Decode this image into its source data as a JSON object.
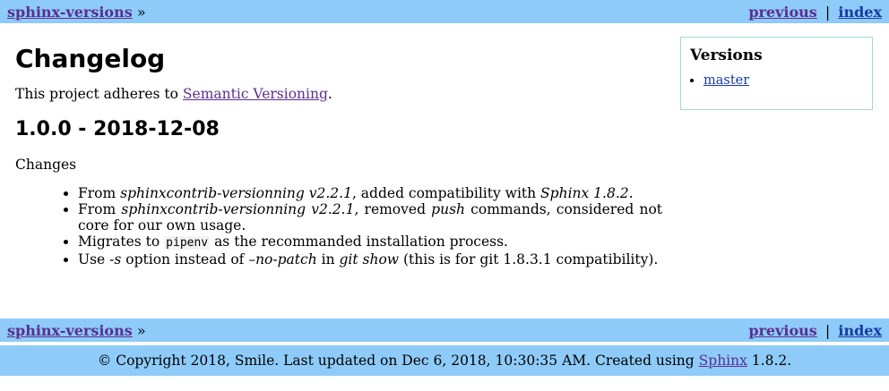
{
  "topbar": {
    "project_link": "sphinx-versions",
    "breadcrumb_sep": "»",
    "previous_link": "previous",
    "separator": "|",
    "index_link": "index"
  },
  "page": {
    "title": "Changelog",
    "intro_prefix": "This project adheres to ",
    "intro_link": "Semantic Versioning",
    "intro_suffix": ".",
    "release_heading": "1.0.0 - 2018-12-08",
    "changes_label": "Changes",
    "changes": [
      {
        "t1": "From ",
        "e1": "sphinxcontrib-versionning v2.2.1",
        "t2": ", added compatibility with ",
        "e2": "Sphinx 1.8.2",
        "t3": "."
      },
      {
        "t1": "From ",
        "e1": "sphinxcontrib-versionning v2.2.1",
        "t2": ", removed ",
        "e2": "push",
        "t3": " commands, considered not core for our own usage."
      },
      {
        "t1": "Migrates to ",
        "code": "pipenv",
        "t2": " as the recommanded installation process."
      },
      {
        "t1": "Use ",
        "e1": "-s",
        "t2": " option instead of ",
        "e2": "–no-patch",
        "t3": " in ",
        "e3": "git show",
        "t4": " (this is for git 1.8.3.1 compatibility)."
      }
    ]
  },
  "sidebar": {
    "title": "Versions",
    "items": [
      "master"
    ]
  },
  "bottombar": {
    "project_link": "sphinx-versions",
    "breadcrumb_sep": "»",
    "previous_link": "previous",
    "separator": "|",
    "index_link": "index"
  },
  "footer": {
    "text_prefix": "© Copyright 2018, Smile. Last updated on Dec 6, 2018, 10:30:35 AM. Created using ",
    "link": "Sphinx",
    "text_suffix": " 1.8.2."
  },
  "colors": {
    "relbar_bg": "#8ecbf8",
    "link_visited": "#5b2e91",
    "link": "#1a3aa3",
    "sidebar_border": "#a5d6dd"
  }
}
